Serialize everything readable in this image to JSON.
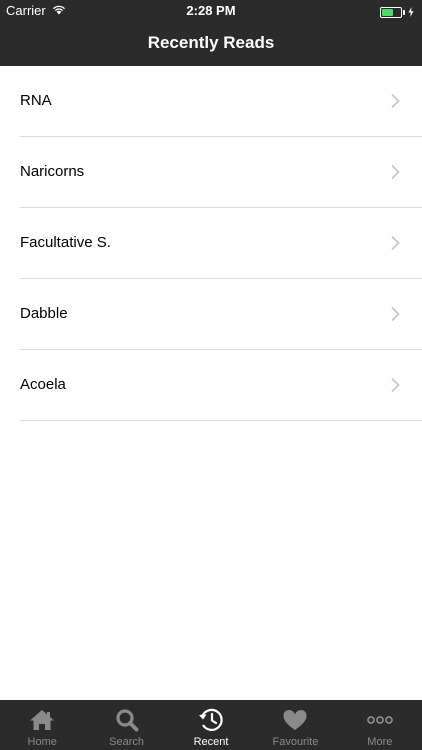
{
  "status": {
    "carrier": "Carrier",
    "time": "2:28 PM",
    "battery_level": 0.55
  },
  "nav": {
    "title": "Recently Reads"
  },
  "list": {
    "items": [
      {
        "label": "RNA"
      },
      {
        "label": "Naricorns"
      },
      {
        "label": "Facultative S."
      },
      {
        "label": "Dabble"
      },
      {
        "label": "Acoela"
      }
    ]
  },
  "tabs": [
    {
      "label": "Home",
      "icon": "home-icon",
      "selected": false
    },
    {
      "label": "Search",
      "icon": "search-icon",
      "selected": false
    },
    {
      "label": "Recent",
      "icon": "history-clock-icon",
      "selected": true
    },
    {
      "label": "Favourite",
      "icon": "heart-icon",
      "selected": false
    },
    {
      "label": "More",
      "icon": "more-dots-icon",
      "selected": false
    }
  ],
  "colors": {
    "bar_bg": "#2b2b2b",
    "battery_green": "#4cd964",
    "tab_inactive": "#8a8a8a",
    "tab_active": "#ffffff"
  }
}
